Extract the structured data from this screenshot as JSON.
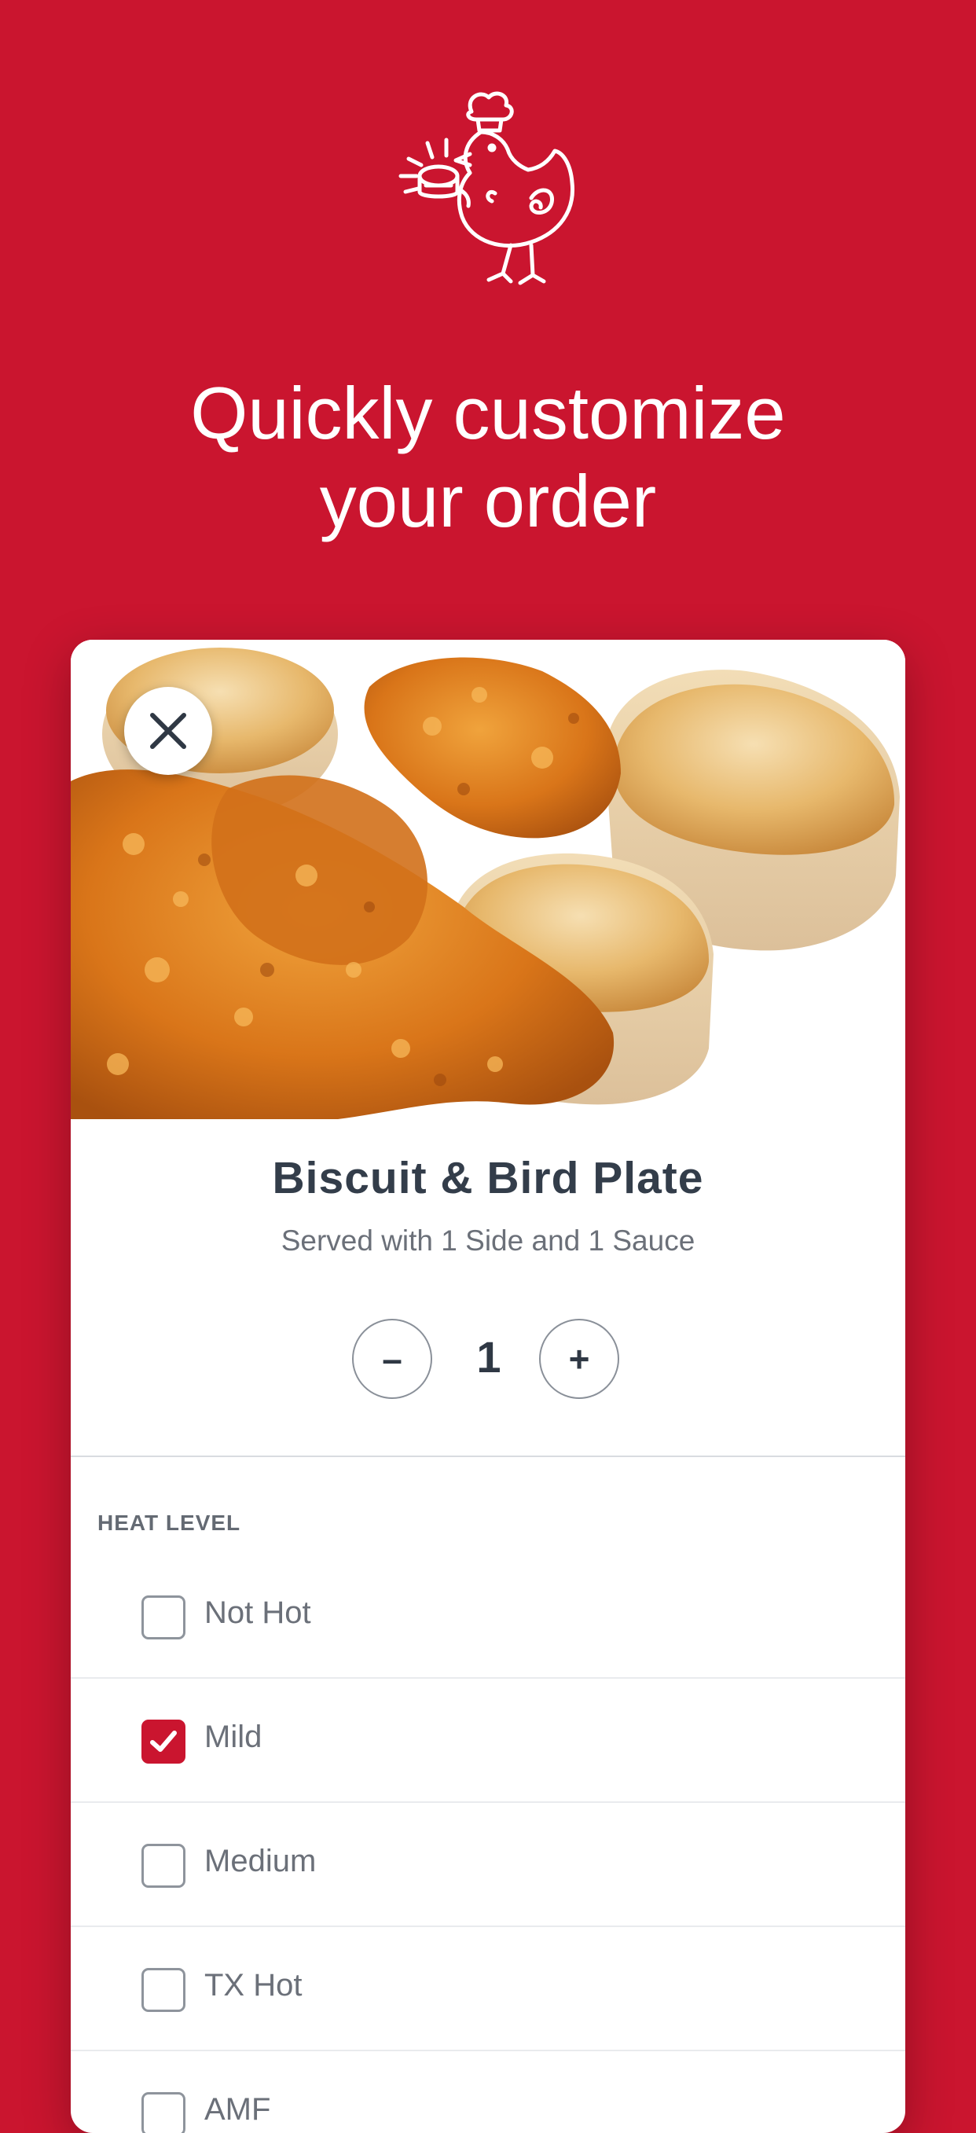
{
  "headline": {
    "line1": "Quickly customize",
    "line2": "your order"
  },
  "product": {
    "title": "Biscuit & Bird Plate",
    "subtitle": "Served with 1 Side and 1 Sauce",
    "quantity": "1",
    "minus_label": "–",
    "plus_label": "+"
  },
  "heat_level": {
    "label": "HEAT LEVEL",
    "options": [
      {
        "label": "Not Hot",
        "checked": false
      },
      {
        "label": "Mild",
        "checked": true
      },
      {
        "label": "Medium",
        "checked": false
      },
      {
        "label": "TX Hot",
        "checked": false
      },
      {
        "label": "AMF",
        "checked": false
      }
    ]
  },
  "icons": {
    "logo": "chicken-chef-logo-icon",
    "close": "close-icon",
    "check": "checkmark-icon"
  },
  "colors": {
    "brand_red": "#ca152f",
    "text_dark": "#333d4a",
    "text_muted": "#6b7079"
  }
}
